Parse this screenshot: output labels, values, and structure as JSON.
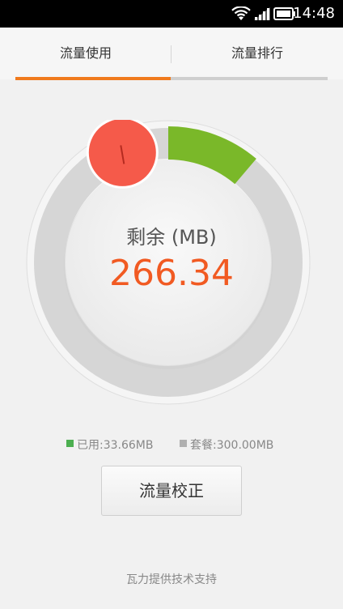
{
  "status_bar": {
    "time": "14:48",
    "icons": [
      "wifi-icon",
      "signal-icon",
      "battery-icon"
    ]
  },
  "tabs": [
    {
      "label": "流量使用",
      "active": true
    },
    {
      "label": "流量排行",
      "active": false
    }
  ],
  "gauge": {
    "label": "剩余 (MB)",
    "remaining": "266.34",
    "used_fraction": 0.1122,
    "colors": {
      "used": "#7ab829",
      "remaining_track": "#d6d6d6",
      "knob": "#f55a4a",
      "value_text": "#f15a22"
    }
  },
  "legend": {
    "used": {
      "label": "已用:33.66MB",
      "color": "#4caf50"
    },
    "plan": {
      "label": "套餐:300.00MB",
      "color": "#b0b0b0"
    }
  },
  "calibrate_button": {
    "label": "流量校正"
  },
  "footer": {
    "text": "瓦力提供技术支持"
  },
  "colors": {
    "accent": "#f07a1d",
    "background": "#f1f1f1"
  }
}
